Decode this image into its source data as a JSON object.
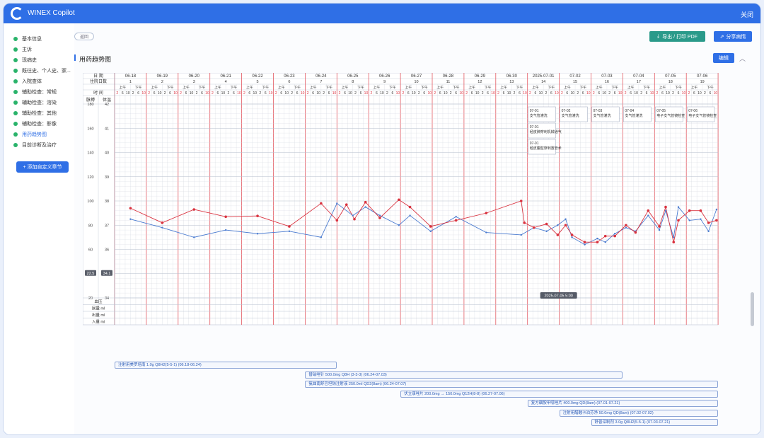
{
  "app": {
    "title": "WINEX Copilot",
    "close_label": "关闭"
  },
  "sidebar": {
    "items": [
      {
        "label": "基本信息"
      },
      {
        "label": "主诉"
      },
      {
        "label": "现病史"
      },
      {
        "label": "既往史、个人史、家..."
      },
      {
        "label": "入院查体"
      },
      {
        "label": "辅助检查：常规"
      },
      {
        "label": "辅助检查：溶染"
      },
      {
        "label": "辅助检查：其他"
      },
      {
        "label": "辅助检查：影像"
      },
      {
        "label": "用药趋势图"
      },
      {
        "label": "目前诊断及治疗"
      }
    ],
    "active_index": 9,
    "add_label": "+ 添加自定义章节"
  },
  "toolbar": {
    "back": "返回",
    "export": "导出 / 打印 PDF",
    "share": "分享病情"
  },
  "section": {
    "title": "用药趋势图",
    "edit": "编辑"
  },
  "chart": {
    "row_date": "日 期",
    "row_day": "住院日数",
    "row_period": "上午 下午",
    "row_time": "时 间",
    "header_pulse": "脉搏",
    "header_temp": "体温",
    "dates": [
      "06-18",
      "06-19",
      "06-20",
      "06-21",
      "06-22",
      "06-23",
      "06-24",
      "06-25",
      "06-26",
      "06-27",
      "06-28",
      "06-29",
      "06-30",
      "2025-07-01",
      "07-02",
      "07-03",
      "07-04",
      "07-05",
      "07-06"
    ],
    "days": [
      "1",
      "2",
      "3",
      "4",
      "5",
      "6",
      "7",
      "8",
      "9",
      "10",
      "11",
      "12",
      "13",
      "14",
      "15",
      "16",
      "17",
      "18",
      "19"
    ],
    "am": "上午",
    "pm": "下午",
    "times": [
      "2",
      "6",
      "10",
      "2",
      "6",
      "10"
    ],
    "pulse_ticks": [
      "180",
      "160",
      "140",
      "120",
      "100",
      "80",
      "60",
      "40",
      "20"
    ],
    "temp_ticks": [
      "42",
      "41",
      "40",
      "39",
      "38",
      "37",
      "36",
      "35",
      "34"
    ],
    "badge_left": "22.5",
    "badge_right": "34.1",
    "tooltip": "2025-07-05 5:00",
    "bottom_rows": [
      "血压",
      "尿量 ml",
      "出量 ml",
      "入量 ml"
    ],
    "annotations": [
      {
        "day": 13,
        "slot": 0,
        "text": "07-01 支气管灌洗"
      },
      {
        "day": 13,
        "slot": 1,
        "text": "07-01 经皮肺穿刺机械通气"
      },
      {
        "day": 13,
        "slot": 2,
        "text": "07-01 经皮腹腔穿刺置管术"
      },
      {
        "day": 14,
        "slot": 0,
        "text": "07-02 支气管灌洗"
      },
      {
        "day": 15,
        "slot": 0,
        "text": "07-03 支气管灌洗"
      },
      {
        "day": 16,
        "slot": 0,
        "text": "07-04 支气管灌洗"
      },
      {
        "day": 17,
        "slot": 0,
        "text": "07-05 电子支气管镜检查"
      },
      {
        "day": 18,
        "slot": 0,
        "text": "07-06 电子支气管镜检查"
      }
    ],
    "colors": {
      "temp": "#d9323f",
      "pulse": "#4a7bd0",
      "grid_red": "#e35a63",
      "grid": "#d0d5de"
    }
  },
  "chart_data": {
    "type": "line",
    "xlabel": "日 期",
    "x_range": [
      0,
      19
    ],
    "series": [
      {
        "unit": "体温",
        "color": "#d9323f",
        "points": [
          [
            0.5,
            37.7
          ],
          [
            1.5,
            37.1
          ],
          [
            2.5,
            37.65
          ],
          [
            3.5,
            37.35
          ],
          [
            4.5,
            37.38
          ],
          [
            5.5,
            36.95
          ],
          [
            6.5,
            37.9
          ],
          [
            7.0,
            37.2
          ],
          [
            7.3,
            37.85
          ],
          [
            7.55,
            37.25
          ],
          [
            7.9,
            37.95
          ],
          [
            8.35,
            37.3
          ],
          [
            8.95,
            38.05
          ],
          [
            9.3,
            37.75
          ],
          [
            9.95,
            36.95
          ],
          [
            10.75,
            37.2
          ],
          [
            11.7,
            37.5
          ],
          [
            12.8,
            38.0
          ],
          [
            12.9,
            37.1
          ],
          [
            13.2,
            36.9
          ],
          [
            13.6,
            37.05
          ],
          [
            13.95,
            36.6
          ],
          [
            14.2,
            37.0
          ],
          [
            14.4,
            36.6
          ],
          [
            14.8,
            36.3
          ],
          [
            15.2,
            36.3
          ],
          [
            15.45,
            36.55
          ],
          [
            15.75,
            36.55
          ],
          [
            16.1,
            37.0
          ],
          [
            16.4,
            36.7
          ],
          [
            16.8,
            37.6
          ],
          [
            17.15,
            36.95
          ],
          [
            17.35,
            37.75
          ],
          [
            17.6,
            36.3
          ],
          [
            17.75,
            37.2
          ],
          [
            18.1,
            37.6
          ],
          [
            18.45,
            37.6
          ],
          [
            18.7,
            37.1
          ],
          [
            18.95,
            37.2
          ]
        ]
      },
      {
        "unit": "脉搏",
        "color": "#4a7bd0",
        "points": [
          [
            0.5,
            85
          ],
          [
            1.5,
            78
          ],
          [
            2.5,
            70
          ],
          [
            3.5,
            76
          ],
          [
            4.5,
            73
          ],
          [
            5.5,
            75
          ],
          [
            6.5,
            70
          ],
          [
            7.0,
            98
          ],
          [
            7.5,
            88
          ],
          [
            7.9,
            95
          ],
          [
            8.35,
            88
          ],
          [
            8.95,
            80
          ],
          [
            9.3,
            88
          ],
          [
            9.95,
            75
          ],
          [
            10.75,
            87
          ],
          [
            11.7,
            74
          ],
          [
            12.8,
            72
          ],
          [
            13.2,
            78
          ],
          [
            13.6,
            75
          ],
          [
            13.95,
            80
          ],
          [
            14.2,
            85
          ],
          [
            14.4,
            70
          ],
          [
            14.8,
            64
          ],
          [
            15.2,
            69
          ],
          [
            15.45,
            66
          ],
          [
            15.75,
            73
          ],
          [
            16.1,
            78
          ],
          [
            16.4,
            75
          ],
          [
            16.8,
            88
          ],
          [
            17.15,
            76
          ],
          [
            17.35,
            92
          ],
          [
            17.6,
            70
          ],
          [
            17.75,
            95
          ],
          [
            18.1,
            84
          ],
          [
            18.45,
            85
          ],
          [
            18.7,
            75
          ],
          [
            18.95,
            93
          ]
        ]
      }
    ],
    "y_left": {
      "label": "脉搏",
      "ticks": [
        180,
        160,
        140,
        120,
        100,
        80,
        60,
        40,
        20
      ]
    },
    "y_right": {
      "label": "体温",
      "ticks": [
        42,
        41,
        40,
        39,
        38,
        37,
        36,
        35,
        34
      ]
    }
  },
  "meds": [
    {
      "text": "注射用美罗培南 1.0g Q8H2(5-5-1) (06.18-06.24)",
      "start": 0,
      "end": 7
    },
    {
      "text": "替硝唑针 500.0mg Q8H (3-3-3) (06.24-07.03)",
      "start": 6,
      "end": 16
    },
    {
      "text": "氨曲南舒巴坦钠注射液 250.0ml QD2(8am) (06.24-07.07)",
      "start": 6,
      "end": 19
    },
    {
      "text": "伏立康唑片 200.0mg → 150.0mg Q12H(8-8) (06.27-07.06)",
      "start": 9,
      "end": 19
    },
    {
      "text": "复方磺胺甲噁唑片 400.0mg QD(8am) (07.01-07.21)",
      "start": 13,
      "end": 19
    },
    {
      "text": "注射用醋酸卡泊芬净 50.0mg QD(8am) (07.02-07.02)",
      "start": 14,
      "end": 19
    },
    {
      "text": "舒普深制剂 3.0g Q8H2(5-5-1) (07.03-07.21)",
      "start": 15,
      "end": 19
    }
  ]
}
